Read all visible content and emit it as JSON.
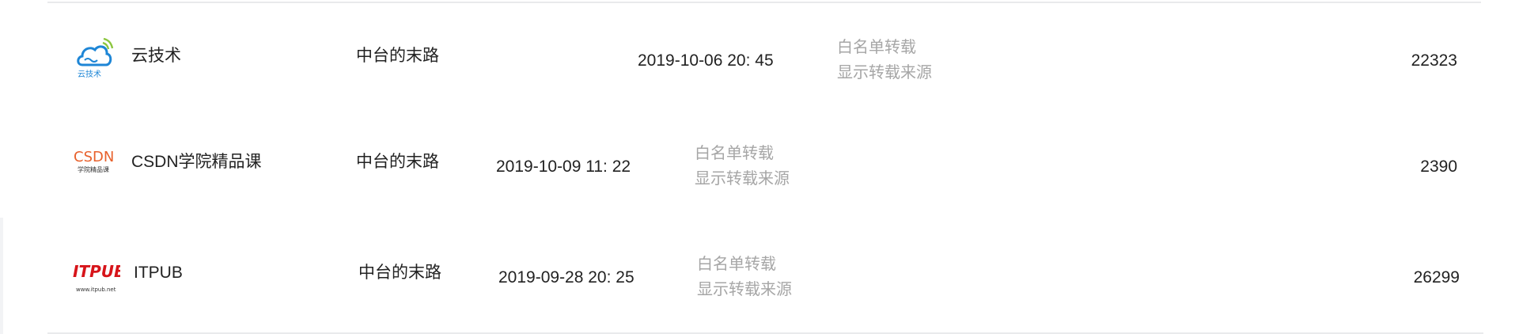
{
  "rows": [
    {
      "logo_icon": "cloud-tech-logo-icon",
      "logo_text": "云技术",
      "source": "云技术",
      "author": "中台的末路",
      "date": "2019-10-06 20: 45",
      "status_line1": "白名单转载",
      "status_line2": "显示转载来源",
      "views": "22323"
    },
    {
      "logo_icon": "csdn-logo-icon",
      "logo_text": "CSDN",
      "logo_subtext": "学院精品课",
      "source": "CSDN学院精品课",
      "author": "中台的末路",
      "date": "2019-10-09 11: 22",
      "status_line1": "白名单转载",
      "status_line2": "显示转载来源",
      "views": "2390"
    },
    {
      "logo_icon": "itpub-logo-icon",
      "logo_text": "ITPUB",
      "logo_subtext": "www.itpub.net",
      "source": "ITPUB",
      "author": "中台的末路",
      "date": "2019-09-28 20: 25",
      "status_line1": "白名单转载",
      "status_line2": "显示转载来源",
      "views": "26299"
    }
  ],
  "colors": {
    "text": "#222222",
    "muted": "#a6a6a6",
    "divider": "#e9eaec",
    "cloud_blue": "#1e86d6",
    "cloud_green": "#8cc63f",
    "csdn_orange": "#e8612c",
    "itpub_red": "#d7141a"
  }
}
